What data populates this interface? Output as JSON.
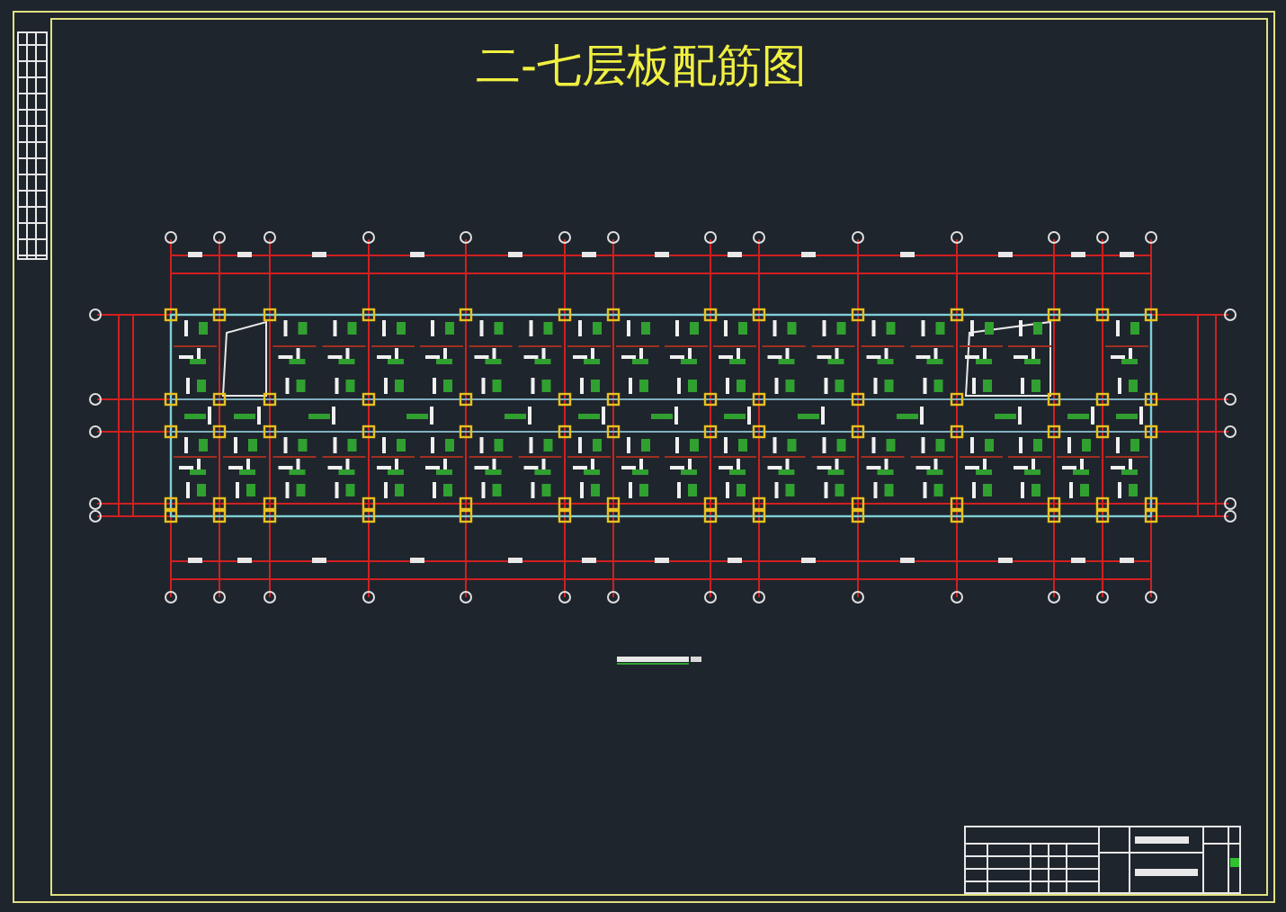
{
  "sheet": {
    "title": "二-七层板配筋图"
  }
}
